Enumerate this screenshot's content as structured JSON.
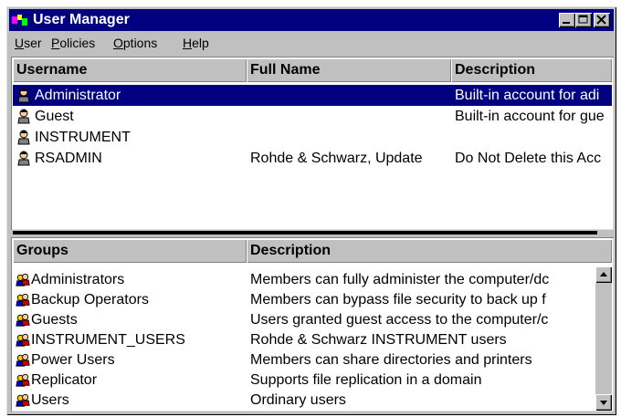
{
  "window": {
    "title": "User Manager"
  },
  "menu": [
    {
      "label": "User",
      "accel": "U",
      "rest": "ser"
    },
    {
      "label": "Policies",
      "accel": "P",
      "rest": "olicies"
    },
    {
      "label": "Options",
      "accel": "O",
      "rest": "ptions"
    },
    {
      "label": "Help",
      "accel": "H",
      "rest": "elp"
    }
  ],
  "users": {
    "columns": [
      "Username",
      "Full Name",
      "Description"
    ],
    "rows": [
      {
        "username": "Administrator",
        "full_name": "",
        "description": "Built-in account for adi",
        "selected": true
      },
      {
        "username": "Guest",
        "full_name": "",
        "description": "Built-in account for gue",
        "selected": false
      },
      {
        "username": "INSTRUMENT",
        "full_name": "",
        "description": "",
        "selected": false
      },
      {
        "username": "RSADMIN",
        "full_name": "Rohde & Schwarz, Update",
        "description": "Do Not Delete this Acc",
        "selected": false
      }
    ]
  },
  "groups": {
    "columns": [
      "Groups",
      "Description"
    ],
    "rows": [
      {
        "name": "Administrators",
        "description": "Members can fully administer the computer/dc"
      },
      {
        "name": "Backup Operators",
        "description": "Members can bypass file security to back up f"
      },
      {
        "name": "Guests",
        "description": "Users granted guest access to the computer/c"
      },
      {
        "name": "INSTRUMENT_USERS",
        "description": "Rohde & Schwarz INSTRUMENT users"
      },
      {
        "name": "Power Users",
        "description": "Members can share directories and printers"
      },
      {
        "name": "Replicator",
        "description": "Supports file replication in a domain"
      },
      {
        "name": "Users",
        "description": "Ordinary users"
      }
    ]
  },
  "icons": {
    "user": "user-icon",
    "group": "group-icon",
    "app": "user-manager-app-icon"
  }
}
